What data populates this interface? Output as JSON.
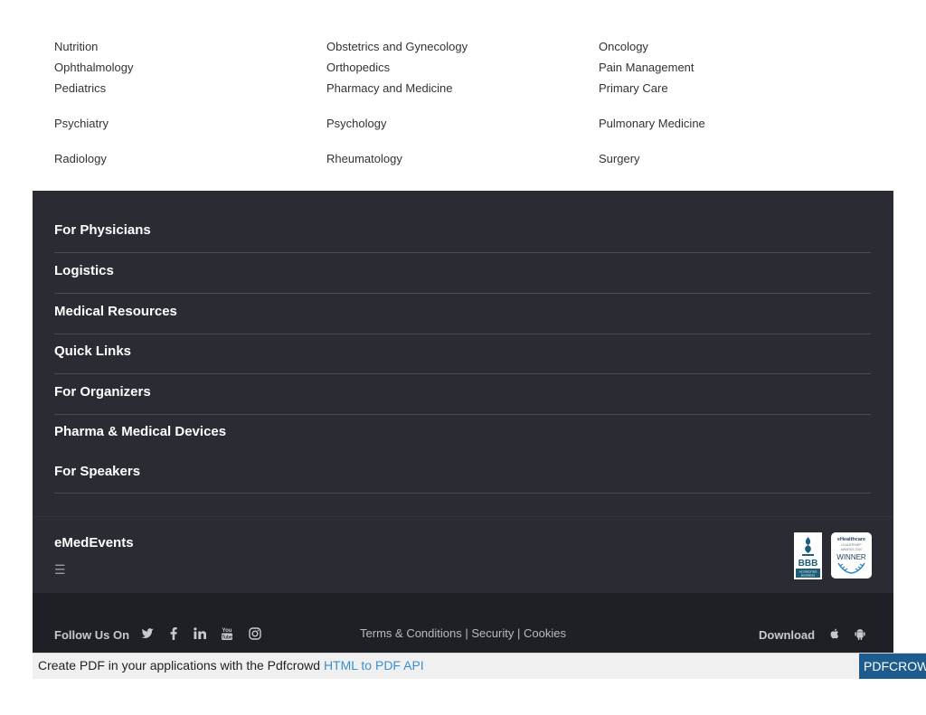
{
  "specialties": {
    "rows": [
      [
        "Nutrition",
        "Obstetrics and Gynecology",
        "Oncology"
      ],
      [
        "Ophthalmology",
        "Orthopedics",
        "Pain Management"
      ],
      [
        "Pediatrics",
        "Pharmacy and Medicine",
        "Primary Care"
      ],
      [
        "Psychiatry",
        "Psychology",
        "Pulmonary Medicine"
      ],
      [
        "Radiology",
        "Rheumatology",
        "Surgery"
      ]
    ]
  },
  "footer": {
    "sections": [
      "For Physicians",
      "Logistics",
      "Medical Resources",
      "Quick Links",
      "For Organizers",
      "Pharma & Medical Devices",
      "For Speakers"
    ]
  },
  "brand": {
    "name": "eMedEvents",
    "menu_icon": "hamburger-menu-icon",
    "menu_glyph": "☰",
    "badges": {
      "bbb_main": "BBB",
      "bbb_sub": "ACCREDITED BUSINESS",
      "ehc_title": "eHealthcare",
      "ehc_sub1": "LEADERSHIP",
      "ehc_sub2": "AWARDS 2020",
      "ehc_winner": "WINNER"
    }
  },
  "bottom": {
    "follow_label": "Follow Us On",
    "social_icons": [
      "twitter-icon",
      "facebook-icon",
      "linkedin-icon",
      "youtube-icon",
      "instagram-icon"
    ],
    "legal": {
      "terms": "Terms & Conditions",
      "security": "Security",
      "cookies": "Cookies",
      "separator": "|"
    },
    "download_label": "Download",
    "app_icons": [
      "apple-icon",
      "android-icon"
    ]
  },
  "pdf_banner": {
    "text": "Create PDF in your applications with the Pdfcrowd ",
    "link": "HTML to PDF API",
    "logo": "PDFCROWD"
  },
  "colors": {
    "footer_bg": "#2b2c33",
    "bottom_bg": "#1f2026",
    "link_blue": "#3a8fd0",
    "pdf_logo_bg": "#1e5b8e"
  }
}
